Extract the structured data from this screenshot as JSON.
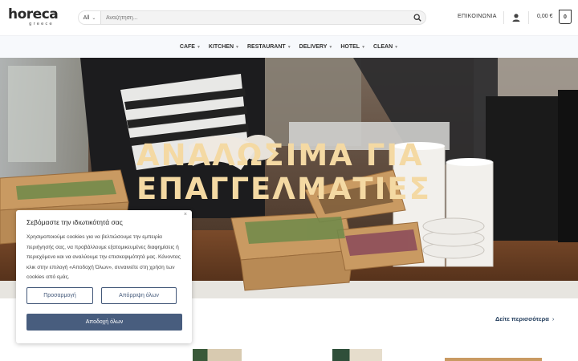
{
  "header": {
    "logo_text": "horeca",
    "logo_sub": "greece",
    "search": {
      "category": "All",
      "placeholder": "Αναζήτηση..."
    },
    "contact_label": "ΕΠΙΚΟΙΝΩΝΙΑ",
    "cart_price": "0,00 €",
    "cart_count": "0"
  },
  "nav": {
    "items": [
      {
        "label": "CAFE"
      },
      {
        "label": "KITCHEN"
      },
      {
        "label": "RESTAURANT"
      },
      {
        "label": "DELIVERY"
      },
      {
        "label": "HOTEL"
      },
      {
        "label": "CLEAN"
      }
    ]
  },
  "hero": {
    "title_line1": "ΑΝΑΛΩΣΙΜΑ ΓΙΑ",
    "title_line2": "ΕΠΑΓΓΕΛΜΑΤΙΕΣ"
  },
  "section": {
    "see_more": "Δείτε περισσότερα",
    "see_more_arrow": "›"
  },
  "cookie": {
    "title": "Σεβόμαστε την ιδιωτικότητά σας",
    "close": "×",
    "text": "Χρησιμοποιούμε cookies για να βελτιώσουμε την εμπειρία περιήγησής σας, να προβάλλουμε εξατομικευμένες διαφημίσεις ή περιεχόμενο και να αναλύουμε την επισκεψιμότητά μας. Κάνοντας κλικ στην επιλογή «Αποδοχή Όλων», συναινείτε στη χρήση των cookies από εμάς.",
    "customize_label": "Προσαρμογή",
    "reject_label": "Απόρριψη όλων",
    "accept_label": "Αποδοχή όλων"
  },
  "colors": {
    "accent": "#485d7e",
    "hero_text": "#f4d9a3",
    "nav_bg": "#f7f9fc"
  }
}
